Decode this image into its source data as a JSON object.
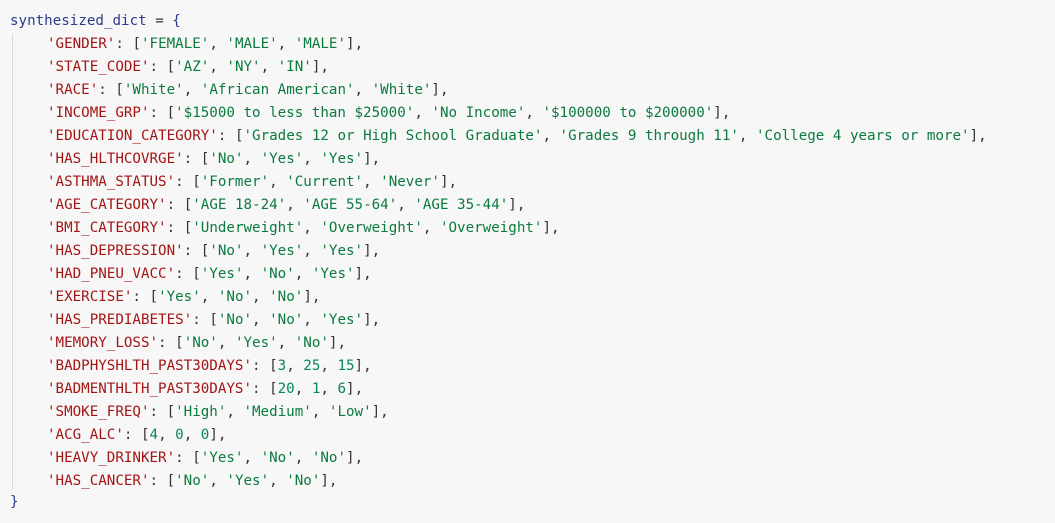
{
  "variable": "synthesized_dict",
  "operator": " = ",
  "open_brace": "{",
  "close_brace": "}",
  "entries": [
    {
      "key": "'GENDER'",
      "value": "['FEMALE', 'MALE', 'MALE']",
      "kind": "str"
    },
    {
      "key": "'STATE_CODE'",
      "value": "['AZ', 'NY', 'IN']",
      "kind": "str"
    },
    {
      "key": "'RACE'",
      "value": "['White', 'African American', 'White']",
      "kind": "str"
    },
    {
      "key": "'INCOME_GRP'",
      "value": "['$15000 to less than $25000', 'No Income', '$100000 to $200000']",
      "kind": "str"
    },
    {
      "key": "'EDUCATION_CATEGORY'",
      "value": "['Grades 12 or High School Graduate', 'Grades 9 through 11', 'College 4 years or more']",
      "kind": "str"
    },
    {
      "key": "'HAS_HLTHCOVRGE'",
      "value": "['No', 'Yes', 'Yes']",
      "kind": "str"
    },
    {
      "key": "'ASTHMA_STATUS'",
      "value": "['Former', 'Current', 'Never']",
      "kind": "str"
    },
    {
      "key": "'AGE_CATEGORY'",
      "value": "['AGE 18-24', 'AGE 55-64', 'AGE 35-44']",
      "kind": "str"
    },
    {
      "key": "'BMI_CATEGORY'",
      "value": "['Underweight', 'Overweight', 'Overweight']",
      "kind": "str"
    },
    {
      "key": "'HAS_DEPRESSION'",
      "value": "['No', 'Yes', 'Yes']",
      "kind": "str"
    },
    {
      "key": "'HAD_PNEU_VACC'",
      "value": "['Yes', 'No', 'Yes']",
      "kind": "str"
    },
    {
      "key": "'EXERCISE'",
      "value": "['Yes', 'No', 'No']",
      "kind": "str"
    },
    {
      "key": "'HAS_PREDIABETES'",
      "value": "['No', 'No', 'Yes']",
      "kind": "str"
    },
    {
      "key": "'MEMORY_LOSS'",
      "value": "['No', 'Yes', 'No']",
      "kind": "str"
    },
    {
      "key": "'BADPHYSHLTH_PAST30DAYS'",
      "value": "[3, 25, 15]",
      "kind": "num"
    },
    {
      "key": "'BADMENTHLTH_PAST30DAYS'",
      "value": "[20, 1, 6]",
      "kind": "num"
    },
    {
      "key": "'SMOKE_FREQ'",
      "value": "['High', 'Medium', 'Low']",
      "kind": "str"
    },
    {
      "key": "'ACG_ALC'",
      "value": "[4, 0, 0]",
      "kind": "num"
    },
    {
      "key": "'HEAVY_DRINKER'",
      "value": "['Yes', 'No', 'No']",
      "kind": "str"
    },
    {
      "key": "'HAS_CANCER'",
      "value": "['No', 'Yes', 'No']",
      "kind": "str"
    }
  ],
  "colors": {
    "background": "#f7f7f7",
    "variable": "#2b3a8c",
    "key": "#a31515",
    "string": "#0b7a3e",
    "number": "#098658"
  }
}
